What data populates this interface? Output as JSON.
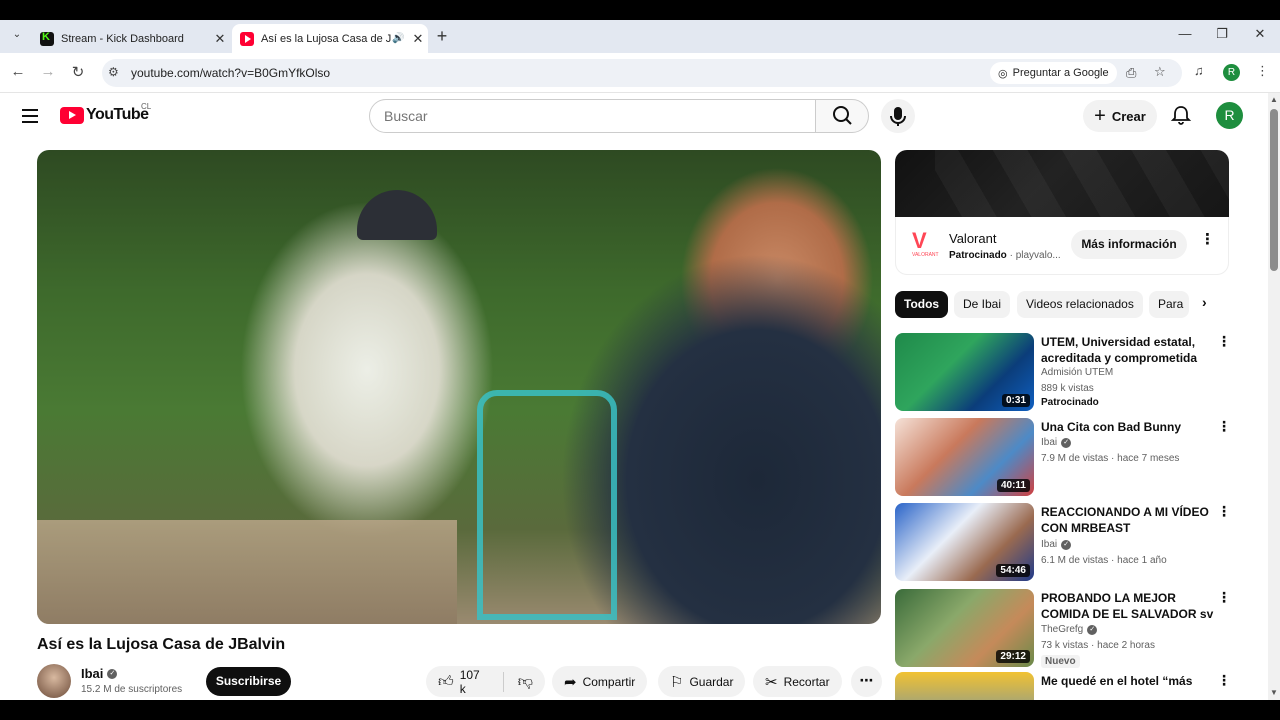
{
  "browser": {
    "tabs": [
      {
        "title": "Stream - Kick Dashboard",
        "favicon": "kick-icon"
      },
      {
        "title": "Así es la Lujosa Casa de JBa",
        "favicon": "youtube-icon",
        "audio": true
      }
    ],
    "url": "youtube.com/watch?v=B0GmYfkOlso",
    "ask_google": "Preguntar a Google",
    "profile_initial": "R"
  },
  "youtube": {
    "logo_text": "YouTube",
    "country": "CL",
    "search_placeholder": "Buscar",
    "create_label": "Crear",
    "avatar_initial": "R"
  },
  "video": {
    "title": "Así es la Lujosa Casa de JBalvin",
    "channel": "Ibai",
    "subscribers": "15.2 M de suscriptores",
    "subscribe_label": "Suscribirse",
    "likes": "107 k",
    "share_label": "Compartir",
    "save_label": "Guardar",
    "clip_label": "Recortar"
  },
  "ad": {
    "name": "Valorant",
    "sponsored": "Patrocinado",
    "domain": "playvalo...",
    "logo_text": "VALORANT",
    "cta": "Más información"
  },
  "chips": [
    "Todos",
    "De Ibai",
    "Videos relacionados",
    "Para"
  ],
  "recommendations": [
    {
      "title": "UTEM, Universidad estatal, acreditada y comprometida co...",
      "channel": "Admisión UTEM",
      "meta": "889 k vistas",
      "badge": "Patrocinado",
      "duration": "0:31",
      "verified": false
    },
    {
      "title": "Una Cita con Bad Bunny",
      "channel": "Ibai",
      "meta": "7.9 M de vistas · hace 7 meses",
      "duration": "40:11",
      "verified": true
    },
    {
      "title": "REACCIONANDO A MI VÍDEO CON MRBEAST",
      "channel": "Ibai",
      "meta": "6.1 M de vistas · hace 1 año",
      "duration": "54:46",
      "verified": true
    },
    {
      "title": "PROBANDO LA MEJOR COMIDA DE EL SALVADOR sv",
      "channel": "TheGrefg",
      "meta": "73 k vistas · hace 2 horas",
      "badge": "Nuevo",
      "duration": "29:12",
      "verified": true
    },
    {
      "title": "Me quedé en el hotel “más",
      "channel": "",
      "meta": "",
      "duration": "",
      "verified": false
    }
  ]
}
